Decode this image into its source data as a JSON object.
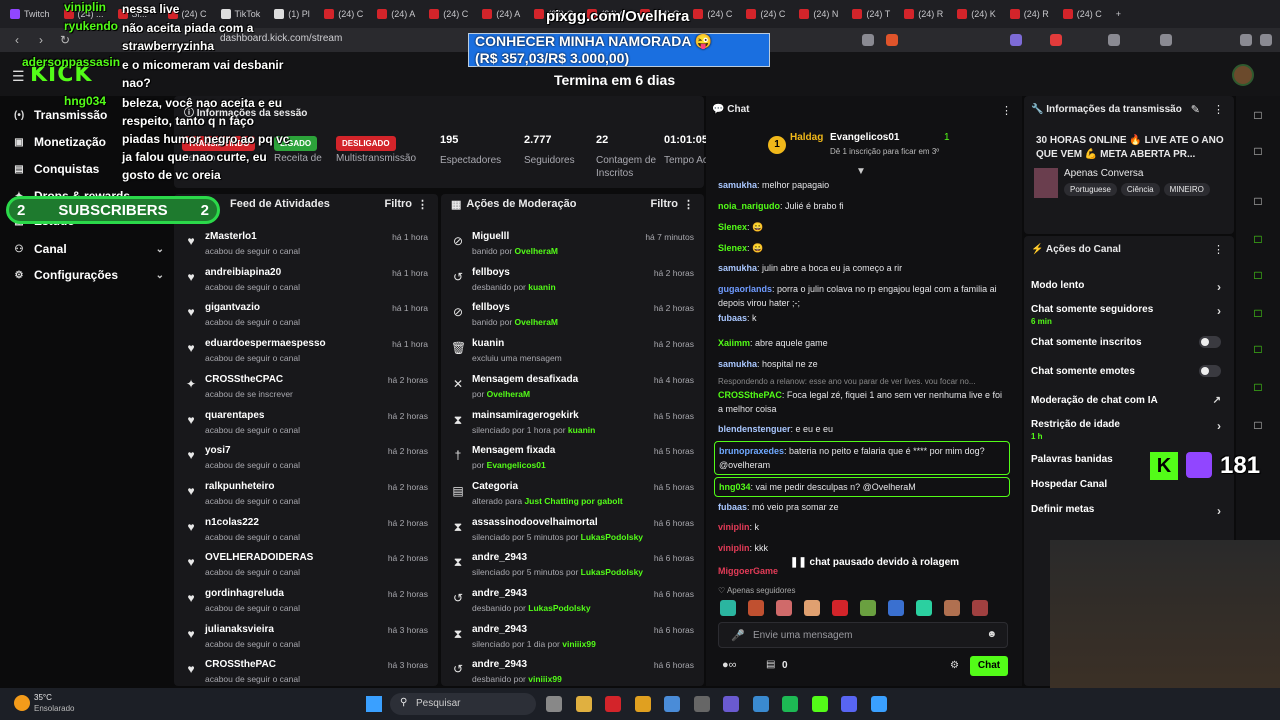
{
  "browser": {
    "tabs": [
      "Twitch",
      "(24) ...",
      "Si...",
      "(24) C",
      "TikTok",
      "(1) Pl",
      "(24) C",
      "(24) A",
      "(24) C",
      "(24) A",
      "(24) C",
      "(24) C",
      "(24) C",
      "(24) C",
      "(24) C",
      "(24) N",
      "(24) T",
      "(24) R",
      "(24) K",
      "(24) R",
      "(24) C"
    ],
    "url": "dashboard.kick.com/stream",
    "new_tab": "+"
  },
  "overlay": {
    "domain_text": "pixgg.com/Ovelhera",
    "goal_line1": "CONHECER MINHA NAMORADA 😜",
    "goal_line2": "(R$ 357,03/R$ 3.000,00)",
    "countdown": "Termina em 6 dias",
    "subs_left": "2",
    "subs_label": "SUBSCRIBERS",
    "subs_right": "2",
    "viewer_count": "181",
    "chat_lines": [
      {
        "user": "viniplin",
        "text": "nessa live"
      },
      {
        "user": "ryukendo",
        "text": "não aceita piada com a strawberryzinha"
      },
      {
        "user": "adersonpassasin",
        "text": "e o micomeram vai desbanir nao?"
      },
      {
        "user": "hng034",
        "text": "beleza, você nao aceita e eu respeito, tanto q n faço piadas humor negro ao pq vc ja falou que nao curte, eu gosto de vc oreia"
      }
    ]
  },
  "header": {
    "logo": "KICK"
  },
  "sidebar": {
    "items": [
      {
        "label": "Transmissão",
        "icon": "broadcast-icon",
        "chev": false
      },
      {
        "label": "Monetização",
        "icon": "money-icon",
        "chev": false
      },
      {
        "label": "Conquistas",
        "icon": "trophy-icon",
        "chev": false
      },
      {
        "label": "Drops & rewards",
        "icon": "gift-icon",
        "chev": false
      },
      {
        "label": "Estudo",
        "icon": "grid-icon",
        "chev": false
      },
      {
        "label": "Canal",
        "icon": "users-icon",
        "chev": true
      },
      {
        "label": "Configurações",
        "icon": "gear-icon",
        "chev": true
      }
    ]
  },
  "session": {
    "title": "Informações da sessão",
    "pills": [
      "TRANSMITINDO",
      "LIGADO",
      "DESLIGADO"
    ],
    "stats": [
      {
        "value": "",
        "label": "Sessão"
      },
      {
        "value": "",
        "label": "Receita de"
      },
      {
        "value": "",
        "label": "Multistransmissão"
      },
      {
        "value": "195",
        "label": "Espectadores"
      },
      {
        "value": "2.777",
        "label": "Seguidores"
      },
      {
        "value": "22",
        "label": "Contagem de Inscritos"
      },
      {
        "value": "01:01:05",
        "label": "Tempo Ao Vivo"
      }
    ]
  },
  "activity": {
    "title": "Feed de Atividades",
    "filter": "Filtro",
    "rows": [
      {
        "name": "zMasterlo1",
        "sub": "acabou de seguir o canal",
        "time": "há 1 hora",
        "icon": "heart-icon"
      },
      {
        "name": "andreibiapina20",
        "sub": "acabou de seguir o canal",
        "time": "há 1 hora",
        "icon": "heart-icon"
      },
      {
        "name": "gigantvazio",
        "sub": "acabou de seguir o canal",
        "time": "há 1 hora",
        "icon": "heart-icon"
      },
      {
        "name": "eduardoespermaespesso",
        "sub": "acabou de seguir o canal",
        "time": "há 1 hora",
        "icon": "heart-icon"
      },
      {
        "name": "CROSStheCPAC",
        "sub": "acabou de se inscrever",
        "time": "há 2 horas",
        "icon": "star-icon"
      },
      {
        "name": "quarentapes",
        "sub": "acabou de seguir o canal",
        "time": "há 2 horas",
        "icon": "heart-icon"
      },
      {
        "name": "yosi7",
        "sub": "acabou de seguir o canal",
        "time": "há 2 horas",
        "icon": "heart-icon"
      },
      {
        "name": "ralkpunheteiro",
        "sub": "acabou de seguir o canal",
        "time": "há 2 horas",
        "icon": "heart-icon"
      },
      {
        "name": "n1colas222",
        "sub": "acabou de seguir o canal",
        "time": "há 2 horas",
        "icon": "heart-icon"
      },
      {
        "name": "OVELHERADOIDERAS",
        "sub": "acabou de seguir o canal",
        "time": "há 2 horas",
        "icon": "heart-icon"
      },
      {
        "name": "gordinhagreluda",
        "sub": "acabou de seguir o canal",
        "time": "há 2 horas",
        "icon": "heart-icon"
      },
      {
        "name": "julianaksvieira",
        "sub": "acabou de seguir o canal",
        "time": "há 3 horas",
        "icon": "heart-icon"
      },
      {
        "name": "CROSSthePAC",
        "sub": "acabou de seguir o canal",
        "time": "há 3 horas",
        "icon": "heart-icon"
      }
    ]
  },
  "moderation": {
    "title": "Ações de Moderação",
    "filter": "Filtro",
    "rows": [
      {
        "name": "Miguelll",
        "pre": "banido por ",
        "by": "OvelheraM",
        "time": "há 7 minutos",
        "icon": "ban-icon"
      },
      {
        "name": "fellboys",
        "pre": "desbanido por ",
        "by": "kuanin",
        "time": "há 2 horas",
        "icon": "undo-icon"
      },
      {
        "name": "fellboys",
        "pre": "banido por ",
        "by": "OvelheraM",
        "time": "há 2 horas",
        "icon": "ban-icon"
      },
      {
        "name": "kuanin",
        "pre": "excluiu uma mensagem",
        "by": "",
        "time": "há 2 horas",
        "icon": "trash-icon"
      },
      {
        "name": "Mensagem desafixada",
        "pre": "por ",
        "by": "OvelheraM",
        "time": "há 4 horas",
        "icon": "unpin-icon"
      },
      {
        "name": "mainsamiragerogekirk",
        "pre": "silenciado por 1 hora por ",
        "by": "kuanin",
        "time": "há 5 horas",
        "icon": "hourglass-icon"
      },
      {
        "name": "Mensagem fixada",
        "pre": "por ",
        "by": "Evangelicos01",
        "time": "há 5 horas",
        "icon": "pin-icon"
      },
      {
        "name": "Categoria",
        "pre": "alterado para ",
        "by": "Just Chatting por gabolt",
        "time": "há 5 horas",
        "icon": "category-icon"
      },
      {
        "name": "assassinodoovelhaimortal",
        "pre": "silenciado por 5 minutos por ",
        "by": "LukasPodolsky",
        "time": "há 6 horas",
        "icon": "hourglass-icon"
      },
      {
        "name": "andre_2943",
        "pre": "silenciado por 5 minutos por ",
        "by": "LukasPodolsky",
        "time": "há 6 horas",
        "icon": "hourglass-icon"
      },
      {
        "name": "andre_2943",
        "pre": "desbanido por ",
        "by": "LukasPodolsky",
        "time": "há 6 horas",
        "icon": "undo-icon"
      },
      {
        "name": "andre_2943",
        "pre": "silenciado por 1 dia por ",
        "by": "viniiix99",
        "time": "há 6 horas",
        "icon": "hourglass-icon"
      },
      {
        "name": "andre_2943",
        "pre": "desbanido por ",
        "by": "viniiix99",
        "time": "há 6 horas",
        "icon": "undo-icon"
      }
    ]
  },
  "chat": {
    "title": "Chat",
    "pinned_user1": "Haldag",
    "pinned_user2": "Evangelicos01",
    "pinned_count": "1",
    "pinned_sub": "Dê 1 inscrição para ficar em 3º",
    "messages": [
      {
        "user": "samukha",
        "color": "#a9c7ff",
        "text": "melhor papagaio"
      },
      {
        "user": "noia_narigudo",
        "color": "#53fc18",
        "text": "Julié é brabo fi"
      },
      {
        "user": "Slenex",
        "color": "#53fc18",
        "text": "😀"
      },
      {
        "user": "Slenex",
        "color": "#53fc18",
        "text": "😀"
      },
      {
        "user": "samukha",
        "color": "#a9c7ff",
        "text": "julin abre a boca eu ja começo a rir"
      },
      {
        "user": "gugaorlands",
        "color": "#6f9bff",
        "text": "porra o julin colava no rp engajou legal com a familia ai depois virou hater ;-;"
      },
      {
        "user": "fubaas",
        "color": "#a9c7ff",
        "text": "k"
      },
      {
        "user": "Xaiimm",
        "color": "#53fc18",
        "text": "abre aquele game"
      },
      {
        "user": "samukha",
        "color": "#a9c7ff",
        "text": "hospital ne ze"
      }
    ],
    "reply_hint": "Respondendo a relanow: esse ano vou parar de ver lives. vou focar no...",
    "messages2": [
      {
        "user": "CROSSthePAC",
        "color": "#53fc18",
        "text": "Foca legal zé, fiquei 1 ano sem ver nenhuma live e foi a melhor coisa"
      },
      {
        "user": "blendenstenguer",
        "color": "#a9c7ff",
        "text": "e eu e eu"
      }
    ],
    "highlight1": {
      "user": "brunopraxedes",
      "text": "bateria no peito e falaria que é **** por mim dog? @ovelheram"
    },
    "highlight2": {
      "user": "hng034",
      "text": "vai me pedir desculpas n? @OvelheraM"
    },
    "messages3": [
      {
        "user": "fubaas",
        "color": "#a9c7ff",
        "text": "mó veio pra somar ze"
      },
      {
        "user": "viniplin",
        "color": "#e23b57",
        "text": "k"
      },
      {
        "user": "viniplin",
        "color": "#e23b57",
        "text": "kkk"
      }
    ],
    "paused": "chat pausado devido à rolagem",
    "last_user": "MiggoerGame",
    "followers_only": "Apenas seguidores",
    "placeholder": "Envie uma mensagem",
    "points": "0",
    "send": "Chat"
  },
  "info": {
    "title": "Informações da transmissão",
    "stream_title": "30 HORAS ONLINE 🔥 LIVE ATE O ANO QUE VEM 💪 META ABERTA PR...",
    "category": "Apenas Conversa",
    "tags": [
      "Portuguese",
      "Ciência",
      "MINEIRO"
    ]
  },
  "channel_actions": {
    "title": "Ações do Canal",
    "items": [
      {
        "label": "Modo lento",
        "sub": "",
        "kind": "chev"
      },
      {
        "label": "Chat somente seguidores",
        "sub": "6 min",
        "kind": "chev"
      },
      {
        "label": "Chat somente inscritos",
        "sub": "",
        "kind": "toggle"
      },
      {
        "label": "Chat somente emotes",
        "sub": "",
        "kind": "toggle"
      },
      {
        "label": "Moderação de chat com IA",
        "sub": "",
        "kind": "ext"
      },
      {
        "label": "Restrição de idade",
        "sub": "1 h",
        "kind": "chev"
      },
      {
        "label": "Palavras banidas",
        "sub": "",
        "kind": "none"
      },
      {
        "label": "Hospedar Canal",
        "sub": "",
        "kind": "none"
      },
      {
        "label": "Definir metas",
        "sub": "",
        "kind": "chev"
      }
    ]
  },
  "taskbar": {
    "weather_temp": "35°C",
    "weather_desc": "Ensolarado",
    "search": "Pesquisar"
  },
  "colors": {
    "accent": "#53fc18",
    "bg": "#0b0b0c",
    "panel": "#18181b",
    "danger": "#d3242a"
  }
}
